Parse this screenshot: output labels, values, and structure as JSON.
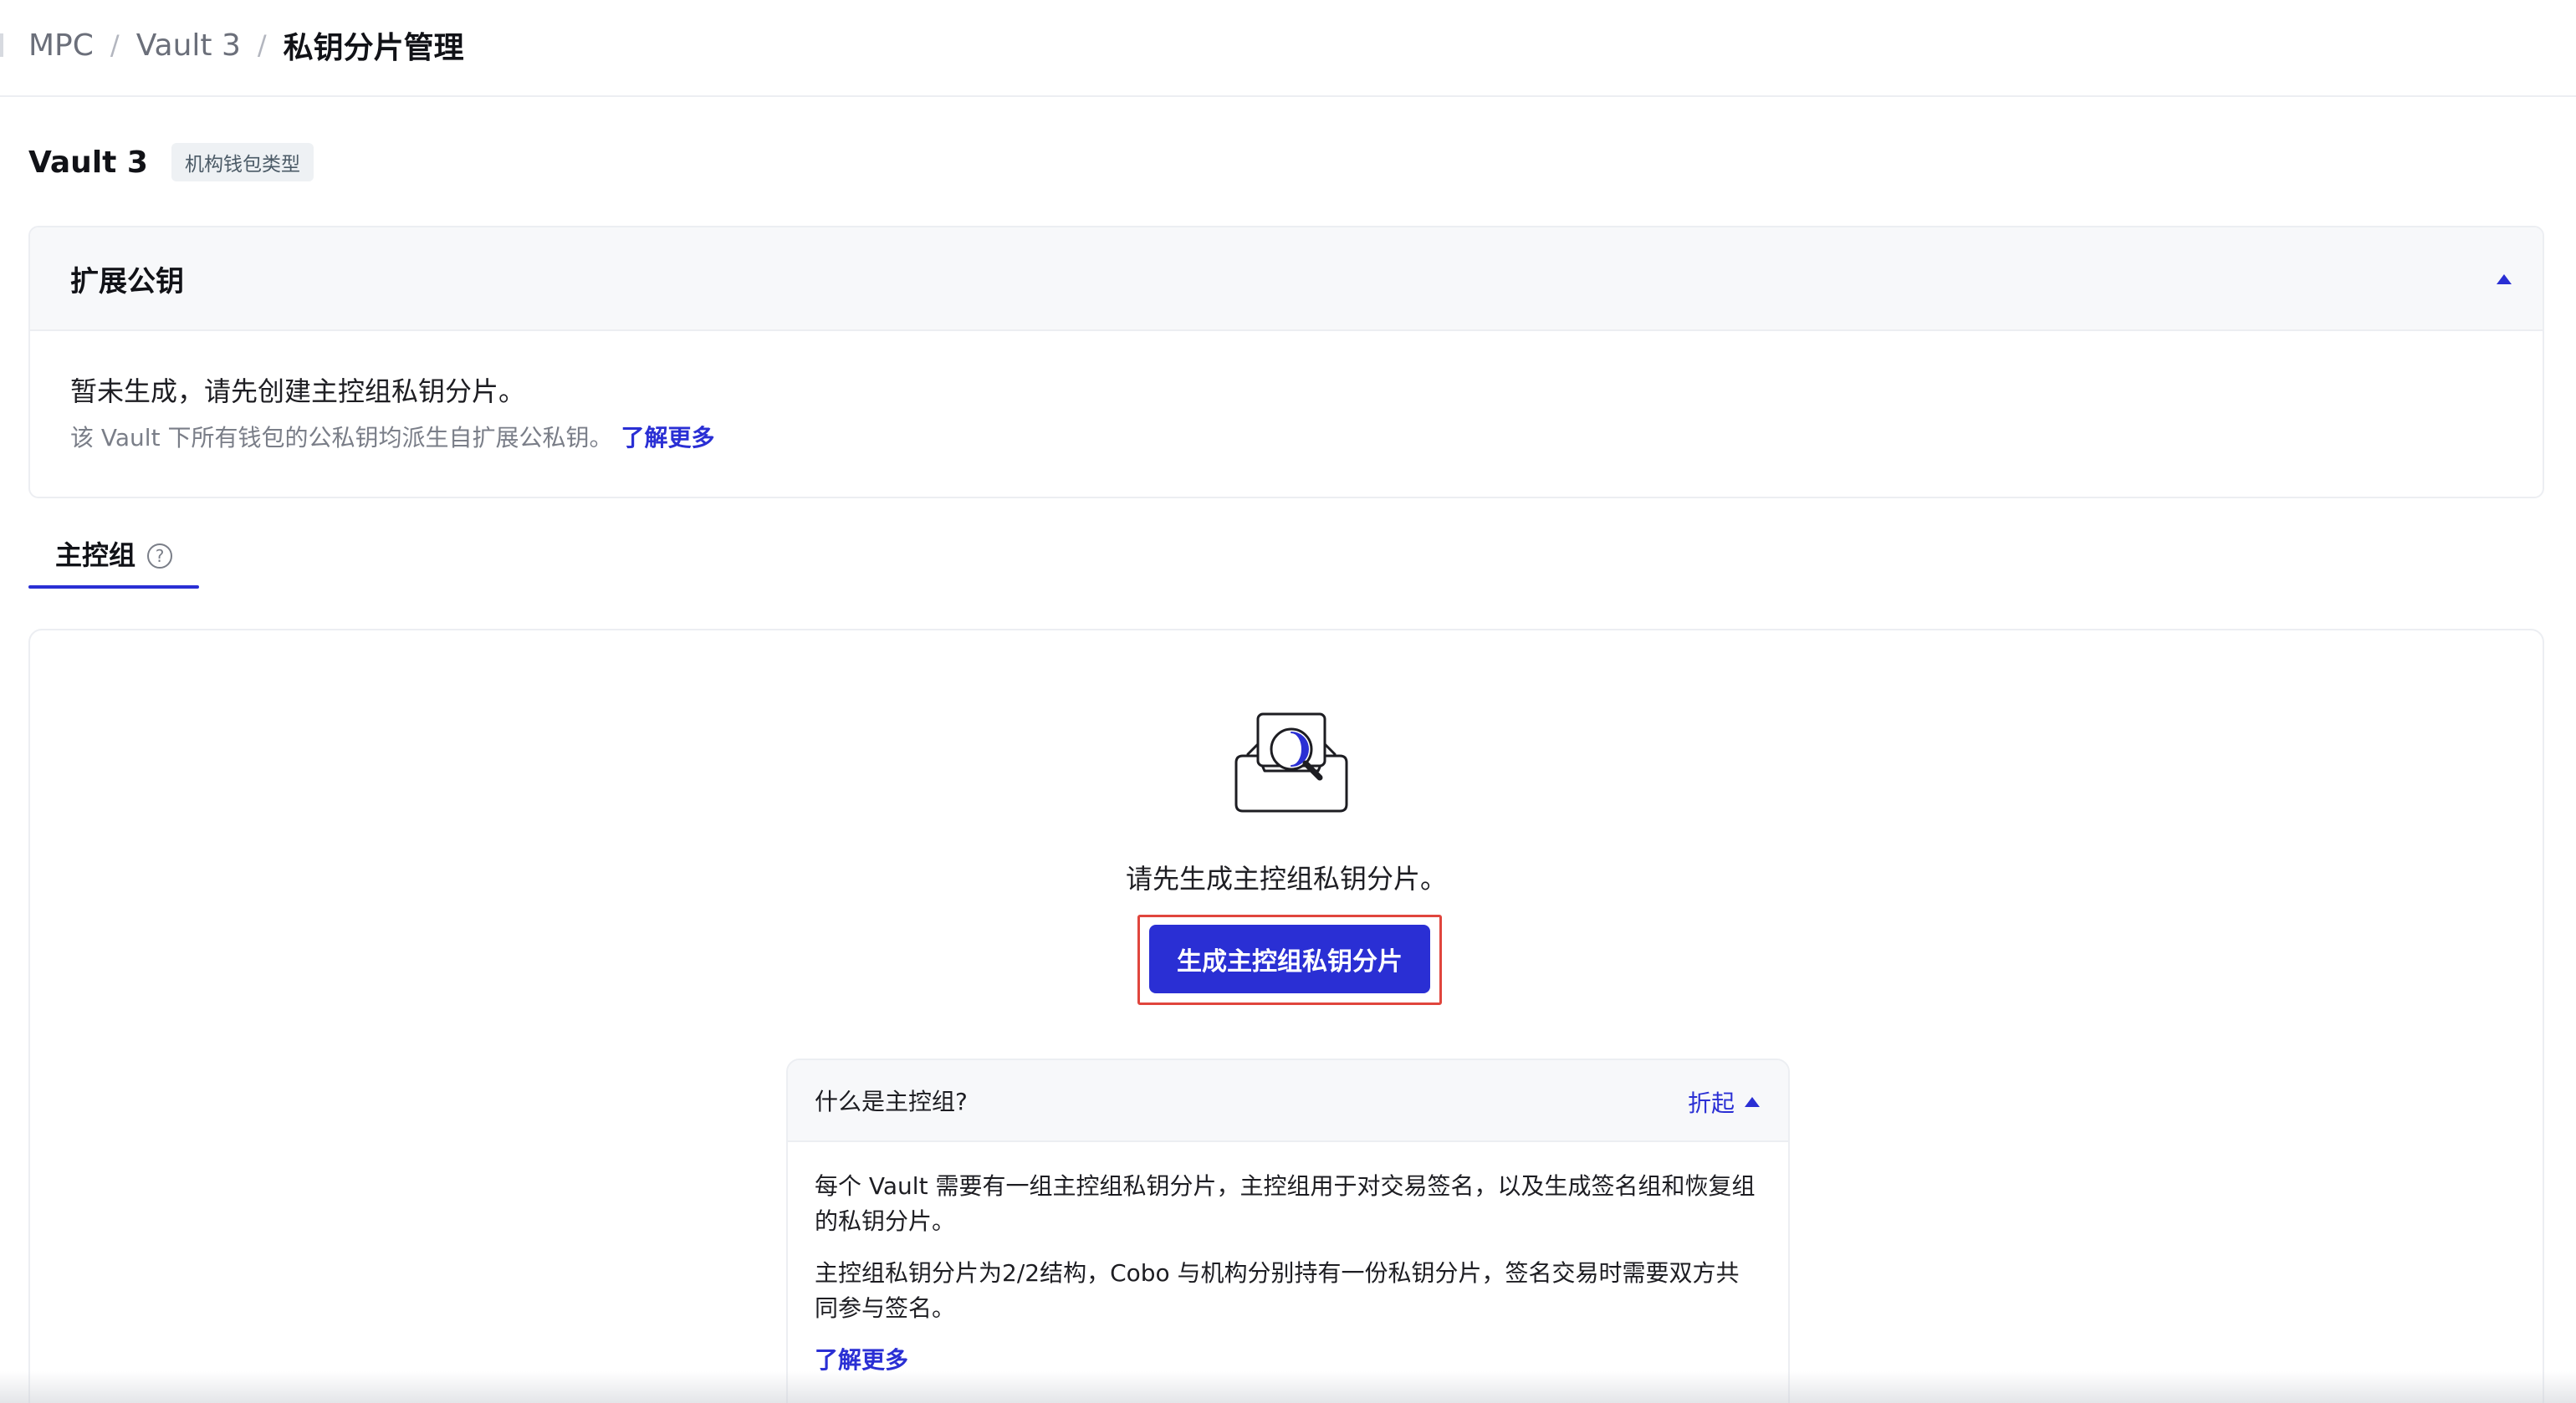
{
  "breadcrumb": {
    "items": [
      "MPC",
      "Vault 3",
      "私钥分片管理"
    ],
    "separator": "/"
  },
  "vault": {
    "name": "Vault 3",
    "tag": "机构钱包类型"
  },
  "xpub": {
    "title": "扩展公钥",
    "toggle_icon": "caret-up-icon",
    "status": "暂未生成，请先创建主控组私钥分片。",
    "description": "该 Vault 下所有钱包的公私钥均派生自扩展公私钥。",
    "learn_more": "了解更多"
  },
  "tabs": [
    {
      "label": "主控组",
      "help_icon": "question-circle-icon",
      "active": true
    }
  ],
  "main": {
    "illustration": "empty-search-icon",
    "empty_text": "请先生成主控组私钥分片。",
    "generate_button": "生成主控组私钥分片"
  },
  "info": {
    "title": "什么是主控组?",
    "fold_label": "折起",
    "paragraph1_line1": "每个 Vault 需要有一组主控组私钥分片，主控组用于对交易签名，以及生成签名组和恢复组",
    "paragraph1_line2": "的私钥分片。",
    "paragraph2_line1": "主控组私钥分片为2/2结构，Cobo 与机构分别持有一份私钥分片，签名交易时需要双方共",
    "paragraph2_line2": "同参与签名。",
    "learn_more": "了解更多"
  },
  "colors": {
    "accent": "#2a2fd4",
    "highlight": "#e0453d",
    "border": "#eceef2",
    "muted_text": "#7a7e88"
  }
}
